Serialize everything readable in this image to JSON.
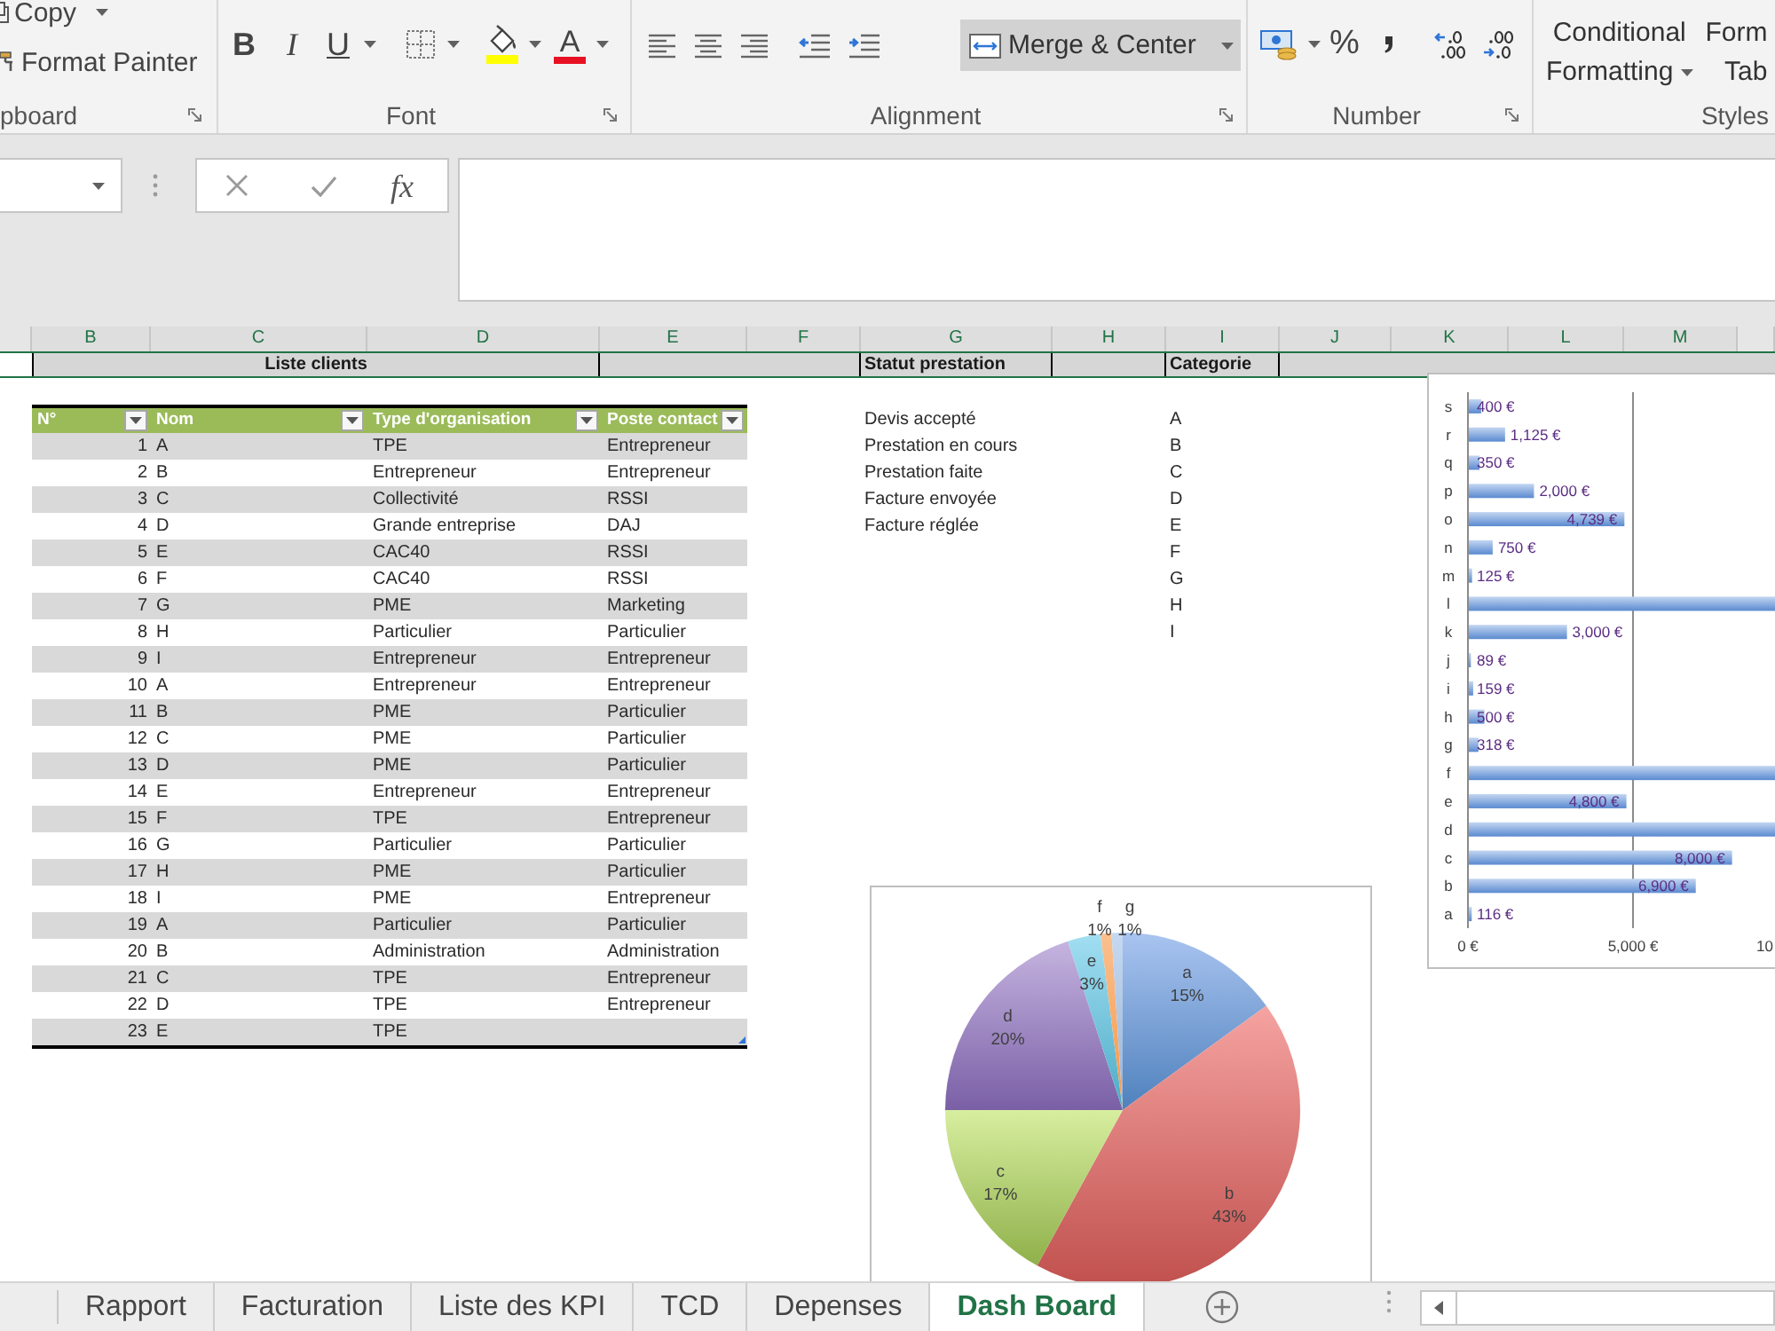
{
  "ribbon": {
    "clipboard": {
      "label": "pboard",
      "copy": "Copy",
      "format_painter": "Format Painter"
    },
    "font": {
      "label": "Font",
      "bold": "B",
      "italic": "I",
      "underline": "U",
      "font_color": "A"
    },
    "alignment": {
      "label": "Alignment",
      "merge": {
        "label": "Merge & Center",
        "on": true
      }
    },
    "number": {
      "label": "Number",
      "percent": "%"
    },
    "styles": {
      "label": "Styles",
      "conditional_formatting": [
        "Conditional",
        "Formatting"
      ],
      "format_as_table": [
        "Form",
        "Tab"
      ]
    }
  },
  "formula_bar": {
    "function_button": "fx"
  },
  "column_headers": [
    "B",
    "C",
    "D",
    "E",
    "F",
    "G",
    "H",
    "I",
    "J",
    "K",
    "L",
    "M"
  ],
  "sheet": {
    "title_row": {
      "selected": true,
      "clients_title": "Liste clients",
      "status_title": "Statut prestation",
      "category_title": "Categorie"
    },
    "client_table": {
      "columns": [
        "N°",
        "Nom",
        "Type d'organisation",
        "Poste contact"
      ],
      "rows": [
        {
          "n": "1",
          "nom": "A",
          "type": "TPE",
          "poste": "Entrepreneur"
        },
        {
          "n": "2",
          "nom": "B",
          "type": "Entrepreneur",
          "poste": "Entrepreneur"
        },
        {
          "n": "3",
          "nom": "C",
          "type": "Collectivité",
          "poste": "RSSI"
        },
        {
          "n": "4",
          "nom": "D",
          "type": "Grande entreprise",
          "poste": "DAJ"
        },
        {
          "n": "5",
          "nom": "E",
          "type": "CAC40",
          "poste": "RSSI"
        },
        {
          "n": "6",
          "nom": "F",
          "type": "CAC40",
          "poste": "RSSI"
        },
        {
          "n": "7",
          "nom": "G",
          "type": "PME",
          "poste": "Marketing"
        },
        {
          "n": "8",
          "nom": "H",
          "type": "Particulier",
          "poste": "Particulier"
        },
        {
          "n": "9",
          "nom": "I",
          "type": "Entrepreneur",
          "poste": "Entrepreneur"
        },
        {
          "n": "10",
          "nom": "A",
          "type": "Entrepreneur",
          "poste": "Entrepreneur"
        },
        {
          "n": "11",
          "nom": "B",
          "type": "PME",
          "poste": "Particulier"
        },
        {
          "n": "12",
          "nom": "C",
          "type": "PME",
          "poste": "Particulier"
        },
        {
          "n": "13",
          "nom": "D",
          "type": "PME",
          "poste": "Particulier"
        },
        {
          "n": "14",
          "nom": "E",
          "type": "Entrepreneur",
          "poste": "Entrepreneur"
        },
        {
          "n": "15",
          "nom": "F",
          "type": "TPE",
          "poste": "Entrepreneur"
        },
        {
          "n": "16",
          "nom": "G",
          "type": "Particulier",
          "poste": "Particulier"
        },
        {
          "n": "17",
          "nom": "H",
          "type": "PME",
          "poste": "Particulier"
        },
        {
          "n": "18",
          "nom": "I",
          "type": "PME",
          "poste": "Entrepreneur"
        },
        {
          "n": "19",
          "nom": "A",
          "type": "Particulier",
          "poste": "Particulier"
        },
        {
          "n": "20",
          "nom": "B",
          "type": "Administration",
          "poste": "Administration"
        },
        {
          "n": "21",
          "nom": "C",
          "type": "TPE",
          "poste": "Entrepreneur"
        },
        {
          "n": "22",
          "nom": "D",
          "type": "TPE",
          "poste": "Entrepreneur"
        },
        {
          "n": "23",
          "nom": "E",
          "type": "TPE"
        }
      ]
    },
    "status_list": [
      "Devis accepté",
      "Prestation en cours",
      "Prestation faite",
      "Facture envoyée",
      "Facture réglée"
    ],
    "category_list": [
      "A",
      "B",
      "C",
      "D",
      "E",
      "F",
      "G",
      "H",
      "I"
    ]
  },
  "bar_chart": {
    "chart_data": {
      "type": "bar",
      "orientation": "horizontal",
      "categories": [
        "s",
        "r",
        "q",
        "p",
        "o",
        "n",
        "m",
        "l",
        "k",
        "j",
        "i",
        "h",
        "g",
        "f",
        "e",
        "d",
        "c",
        "b",
        "a"
      ],
      "values": [
        400,
        1125,
        350,
        2000,
        4739,
        750,
        125,
        9300,
        3000,
        89,
        159,
        500,
        318,
        9300,
        4800,
        9300,
        8000,
        6900,
        116
      ],
      "value_labels": [
        "400 €",
        "1,125 €",
        "350 €",
        "2,000 €",
        "4,739 €",
        "750 €",
        "125 €",
        null,
        "3,000 €",
        "89 €",
        "159 €",
        "500 €",
        "318 €",
        null,
        "4,800 €",
        null,
        "8,000 €",
        "6,900 €",
        "116 €"
      ],
      "xlim": [
        0,
        9300
      ],
      "xticks": [
        {
          "value": 0,
          "label": "0 €"
        },
        {
          "value": 5000,
          "label": "5,000 €"
        }
      ]
    },
    "clipped_tick_label": "10"
  },
  "pie_chart": {
    "chart_data": {
      "type": "pie",
      "categories": [
        "a",
        "b",
        "c",
        "d",
        "e",
        "f",
        "g"
      ],
      "values": [
        15,
        43,
        17,
        20,
        3,
        1,
        1
      ],
      "value_labels": [
        "15%",
        "43%",
        "17%",
        "20%",
        "3%",
        "1%",
        "1%"
      ]
    }
  },
  "sheet_tabs": [
    {
      "label": "Rapport",
      "selected": false
    },
    {
      "label": "Facturation",
      "selected": false
    },
    {
      "label": "Liste des KPI",
      "selected": false
    },
    {
      "label": "TCD",
      "selected": false
    },
    {
      "label": "Depenses",
      "selected": false
    },
    {
      "label": "Dash Board",
      "selected": true
    }
  ]
}
